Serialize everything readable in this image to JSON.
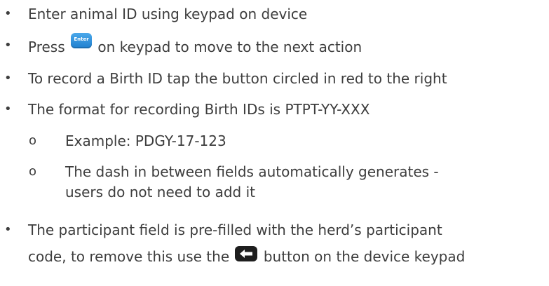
{
  "bullets": {
    "b1": "Enter animal ID using keypad on device",
    "b2_before": "Press",
    "b2_after": "on keypad to move to the next action",
    "b3": "To record a Birth ID tap the button circled in red to the right",
    "b4": "The format for recording Birth IDs is PTPT-YY-XXX",
    "sub1": "Example: PDGY-17-123",
    "sub2_line1": "The dash in between fields automatically generates -",
    "sub2_line2": "users do not need to add it",
    "b5_line1": "The participant field is pre-filled with the herd’s participant",
    "b5_line2_before": "code, to remove this use the",
    "b5_line2_after": "button on the device keypad"
  },
  "markers": {
    "bullet": "•",
    "sub": "o"
  },
  "icons": {
    "enter_key_label": "Enter",
    "enter_key_icon": "enter-key-icon",
    "back_key_icon": "backspace-arrow-key-icon"
  },
  "colors": {
    "text": "#3d3d3d",
    "enter_key": "#2b8fdc",
    "back_key": "#1e1e1e"
  }
}
